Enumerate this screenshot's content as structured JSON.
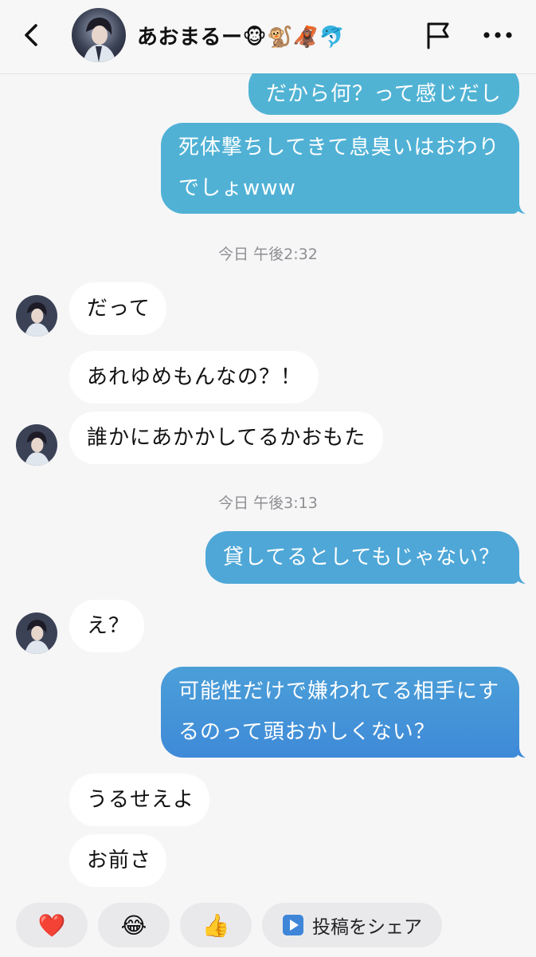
{
  "header": {
    "contact_name": "あおまるー🐵🐒🦧🐬",
    "back_icon": "chevron-left-icon",
    "flag_icon": "flag-icon",
    "more_icon": "more-horizontal-icon"
  },
  "messages": [
    {
      "from": "me",
      "text": "だから何？って感じだし"
    },
    {
      "from": "me",
      "lines": [
        "死体撃ちしてきて息臭いはおわり",
        "でしょwww"
      ]
    },
    {
      "timestamp": "今日 午後2:32"
    },
    {
      "from": "them",
      "text": "だって"
    },
    {
      "from": "them",
      "text": "あれゆめもんなの？！"
    },
    {
      "from": "them",
      "text": "誰かにあかかしてるかおもた"
    },
    {
      "timestamp": "今日 午後3:13"
    },
    {
      "from": "me",
      "text": "貸してるとしてもじゃない？"
    },
    {
      "from": "them",
      "text": "え？"
    },
    {
      "from": "me",
      "lines": [
        "可能性だけで嫌われてる相手にす",
        "るのって頭おかしくない？"
      ]
    },
    {
      "from": "them",
      "text": "うるせえよ"
    },
    {
      "from": "them",
      "text": "お前さ"
    }
  ],
  "quick_reactions": [
    {
      "icon": "heart-icon",
      "glyph": "❤️"
    },
    {
      "icon": "laughing-emoji-icon",
      "glyph": "😂"
    },
    {
      "icon": "thumbs-up-icon",
      "glyph": "👍"
    }
  ],
  "share_button": {
    "icon": "play-square-icon",
    "label": "投稿をシェア"
  },
  "colors": {
    "outgoing_top": "#4fb2d6",
    "outgoing_bottom": "#3f8ad8",
    "incoming": "#ffffff",
    "background": "#f6f6f7"
  }
}
